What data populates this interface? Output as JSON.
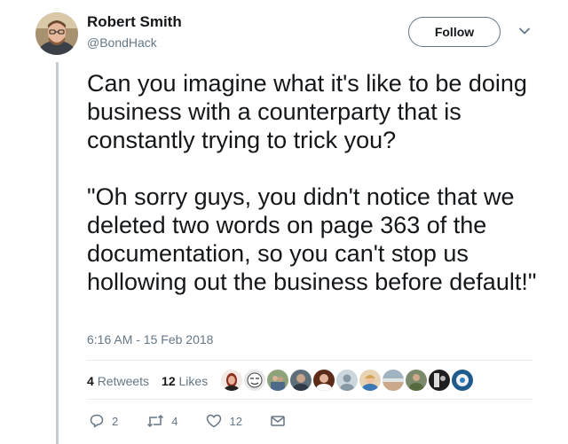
{
  "author": {
    "name": "Robert Smith",
    "handle": "@BondHack"
  },
  "follow_label": "Follow",
  "tweet": {
    "text": "Can you imagine what it's like to be doing business with a counterparty that is constantly trying to trick you?\n\n\"Oh sorry guys, you didn't notice that we deleted two words on page 363 of the documentation, so you can't stop us hollowing out the business before default!\"",
    "timestamp": "6:16 AM - 15 Feb 2018"
  },
  "stats": {
    "retweets_count": "4",
    "retweets_label": "Retweets",
    "likes_count": "12",
    "likes_label": "Likes"
  },
  "actions": {
    "reply_count": "2",
    "retweet_count": "4",
    "like_count": "12"
  },
  "icons": {
    "reply": "reply-icon",
    "retweet": "retweet-icon",
    "like": "heart-icon",
    "dm": "mail-icon",
    "caret": "chevron-down-icon"
  },
  "colors": {
    "text": "#14171a",
    "muted": "#657786",
    "divider": "#e6ecf0",
    "thread_line": "#c7ccd1"
  }
}
